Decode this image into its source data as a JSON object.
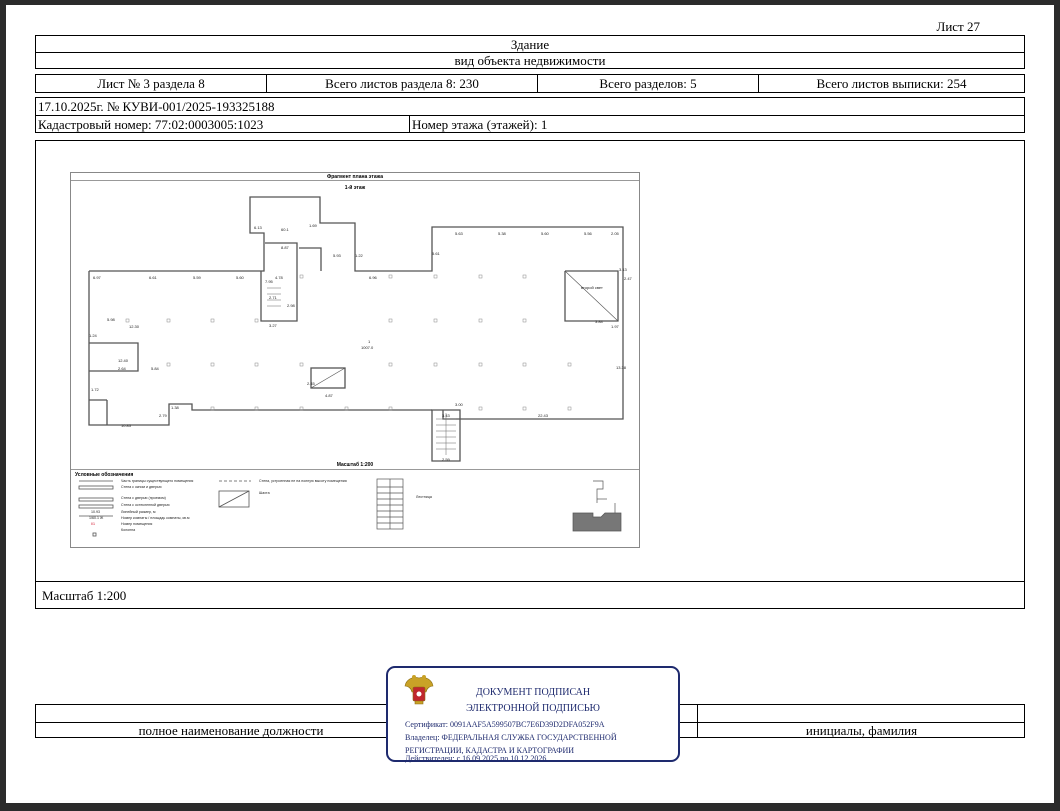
{
  "sheet_label": "Лист 27",
  "header": {
    "title": "Здание",
    "subtitle": "вид объекта недвижимости"
  },
  "info_row": {
    "sheet_in_section": "Лист № 3 раздела 8",
    "total_sheets_section": "Всего листов раздела 8: 230",
    "total_sections": "Всего разделов: 5",
    "total_sheets_extract": "Всего листов выписки: 254"
  },
  "doc_number": "17.10.2025г. № КУВИ-001/2025-193325188",
  "cadastral_number": "Кадастровый номер: 77:02:0003005:1023",
  "floor_number": "Номер этажа (этажей): 1",
  "scale_label": "Масштаб 1:200",
  "plan": {
    "title": "Фрагмент плана этажа",
    "floor": "1-й этаж",
    "scale": "Масштаб 1:200",
    "room_main": "1",
    "room_main_area": "1007.0",
    "second_light": "второй свет",
    "dims": {
      "d1": "6.97",
      "d2": "6.61",
      "d3": "5.59",
      "d4": "5.60",
      "d5": "4.78",
      "d6": "6.96",
      "d7": "5.63",
      "d8": "5.38",
      "d9": "5.60",
      "d10": "5.56",
      "d11": "2.05",
      "d12": "5.98",
      "d13": "12.30",
      "d14": "12.40",
      "d15": "2.64",
      "d16": "5.84",
      "d17": "1.72",
      "d18": "10.83",
      "d19": "2.79",
      "d20": "1.38",
      "d21": "22.43",
      "d22": "3.00",
      "d23": "3.43",
      "d24": "2.59",
      "d25": "3.13",
      "d26": "2.47",
      "d27": "3.84",
      "d28": "1.97",
      "d29": "13.38",
      "d30": "4.87",
      "d31": "2.45",
      "d32": "6.13",
      "d33": "60.1",
      "d34": "1.69",
      "d35": "8.87",
      "d36": "3.27",
      "d37": "2.71",
      "d38": "2.98",
      "d39": "7.95",
      "d40": "5.61",
      "d41": "5.93",
      "d42": "1.22",
      "d43": "1.24"
    },
    "legend": {
      "title": "Условные обозначения",
      "items": [
        "Часть границы существующего помещения",
        "Стена с окном и дверью",
        "Стена с дверью (проемом)",
        "Стена с остекленной дверью",
        "Линейный размер, м",
        "Номер комнаты / площадь комнаты, кв.м",
        "Номер помещения",
        "Колонна"
      ],
      "wall_label": "Стена, устроенная не на полную высоту помещения",
      "shaft_label": "Шахта",
      "stairs_label": "Лестница",
      "legend_dim": "10.93",
      "legend_room": "1/60.1 Ж",
      "legend_room_no": "I/1"
    }
  },
  "stamp": {
    "line1": "ДОКУМЕНТ ПОДПИСАН",
    "line2": "ЭЛЕКТРОННОЙ ПОДПИСЬЮ",
    "certificate": "Сертификат: 0091AAF5A599507BC7E6D39D2DFA052F9A",
    "owner1": "Владелец: ФЕДЕРАЛЬНАЯ СЛУЖБА ГОСУДАРСТВЕННОЙ",
    "owner2": "РЕГИСТРАЦИИ, КАДАСТРА И КАРТОГРАФИИ",
    "valid": "Действителен: с 16.09.2025 по 10.12.2026"
  },
  "footer": {
    "position_label": "полное наименование должности",
    "initials_label": "инициалы, фамилия"
  },
  "colors": {
    "stamp_blue": "#1e2a6e",
    "emblem_gold": "#c9a227",
    "emblem_red": "#c0272d",
    "room_red": "#d0021b"
  }
}
